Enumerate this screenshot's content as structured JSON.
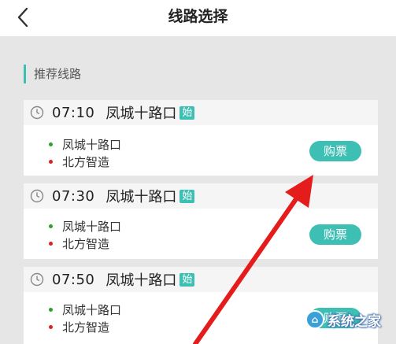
{
  "header": {
    "title": "线路选择",
    "back_icon": "chevron-left-icon"
  },
  "section": {
    "title": "推荐线路",
    "accent": "#3dbfb4"
  },
  "routes": [
    {
      "time": "07:10",
      "origin": "凤城十路口",
      "badge": "始",
      "stops": [
        "凤城十路口",
        "北方智造"
      ],
      "buy_label": "购票"
    },
    {
      "time": "07:30",
      "origin": "凤城十路口",
      "badge": "始",
      "stops": [
        "凤城十路口",
        "北方智造"
      ],
      "buy_label": "购票"
    },
    {
      "time": "07:50",
      "origin": "凤城十路口",
      "badge": "始",
      "stops": [
        "凤城十路口",
        "北方智造"
      ],
      "buy_label": "购票"
    }
  ],
  "watermark": {
    "text": "系统之家"
  },
  "colors": {
    "accent": "#3dbfb4",
    "start_dot": "#2ca02c",
    "end_dot": "#e02020",
    "annotation_arrow": "#e51c1c"
  }
}
